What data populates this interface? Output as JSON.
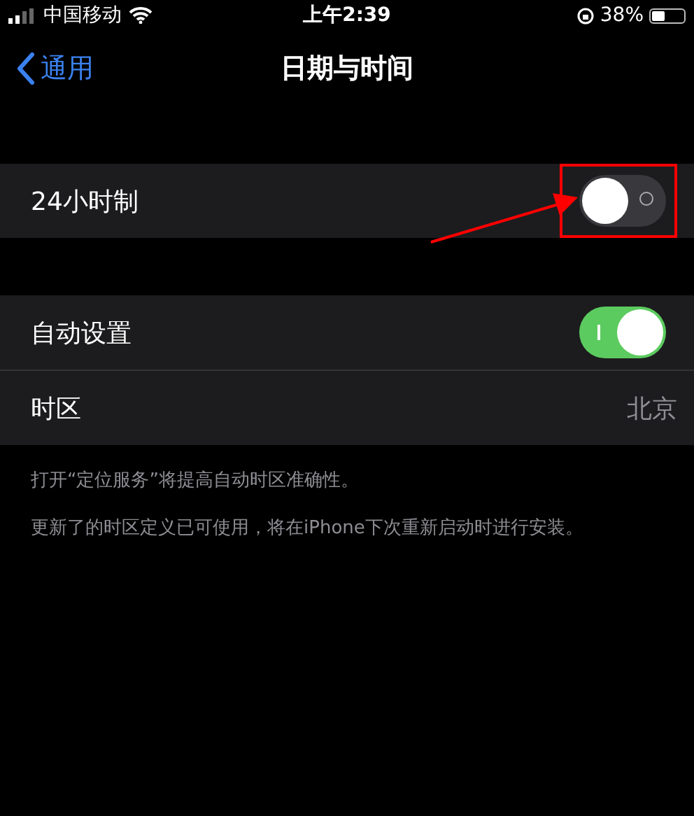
{
  "status_bar": {
    "carrier": "中国移动",
    "time": "上午2:39",
    "battery": "38%"
  },
  "nav": {
    "back": "通用",
    "title": "日期与时间"
  },
  "groups": [
    {
      "rows": [
        {
          "kind": "toggle",
          "label": "24小时制",
          "on": false,
          "highlighted": true
        }
      ]
    },
    {
      "rows": [
        {
          "kind": "toggle",
          "label": "自动设置",
          "on": true,
          "highlighted": false
        },
        {
          "kind": "value",
          "label": "时区",
          "value": "北京"
        }
      ]
    }
  ],
  "footnotes": [
    "打开“定位服务”将提高自动时区准确性。",
    "更新了的时区定义已可使用，将在iPhone下次重新启动时进行安装。"
  ]
}
